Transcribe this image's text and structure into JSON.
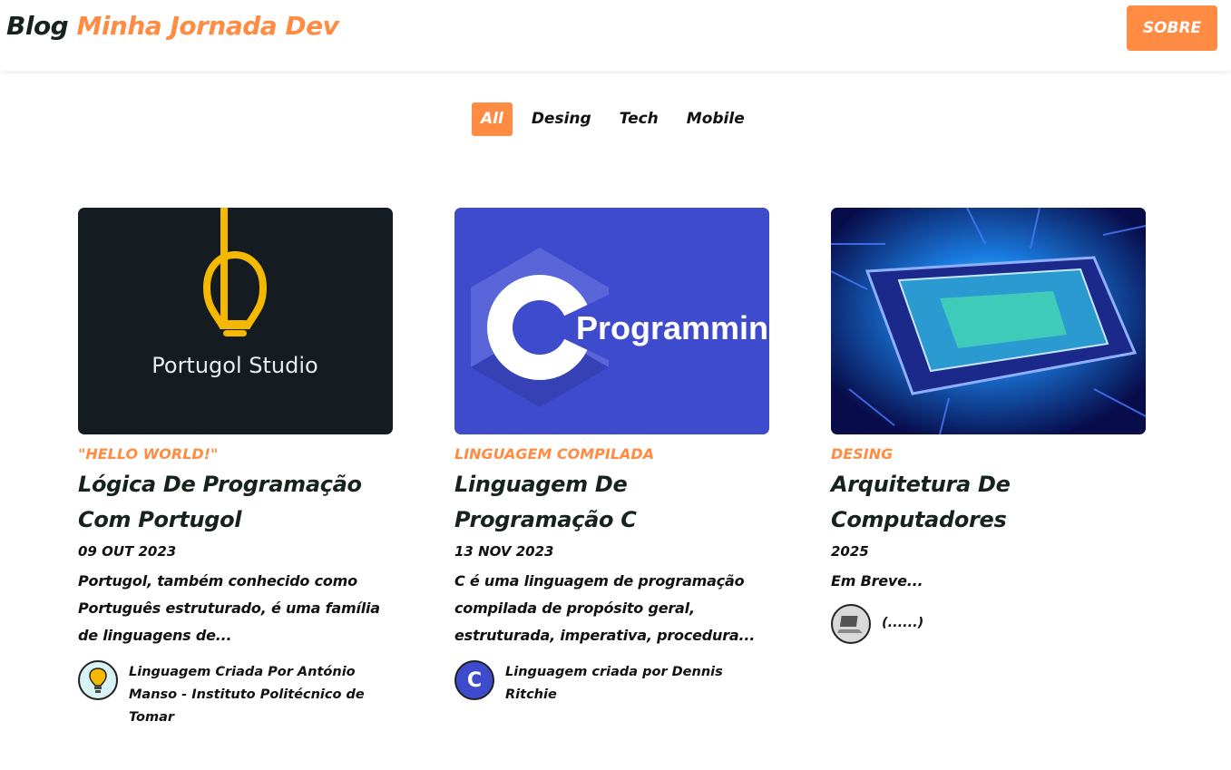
{
  "header": {
    "logo_prefix": "Blog",
    "logo_name": "Minha Jornada Dev",
    "about_button": "SOBRE"
  },
  "filters": [
    "All",
    "Desing",
    "Tech",
    "Mobile"
  ],
  "active_filter": "All",
  "cards": [
    {
      "image_text": "Portugol  Studio",
      "category": "\"Hello World!\"",
      "title": "Lógica De Programação Com Portugol",
      "date": "09 OUT 2023",
      "description": "Portugol, também conhecido como Português estruturado, é uma família de linguagens de...",
      "author": "Linguagem Criada Por António Manso - Instituto Politécnico de Tomar"
    },
    {
      "image_text": "Programming",
      "image_letter": "C",
      "category": "Linguagem compilada",
      "title": "Linguagem De Programação C",
      "date": "13 NOV 2023",
      "description": "C é uma linguagem de programação compilada de propósito geral, estruturada, imperativa, procedura...",
      "author": "Linguagem criada por Dennis Ritchie",
      "avatar_letter": "C"
    },
    {
      "category": "Desing",
      "title": "Arquitetura De Computadores",
      "date": "2025",
      "description": "Em Breve...",
      "author": "(......)"
    }
  ],
  "colors": {
    "accent": "#ff8c42",
    "dark_text": "#16221c",
    "portugol_bg": "#141c22",
    "c_bg": "#3e4bcc"
  }
}
